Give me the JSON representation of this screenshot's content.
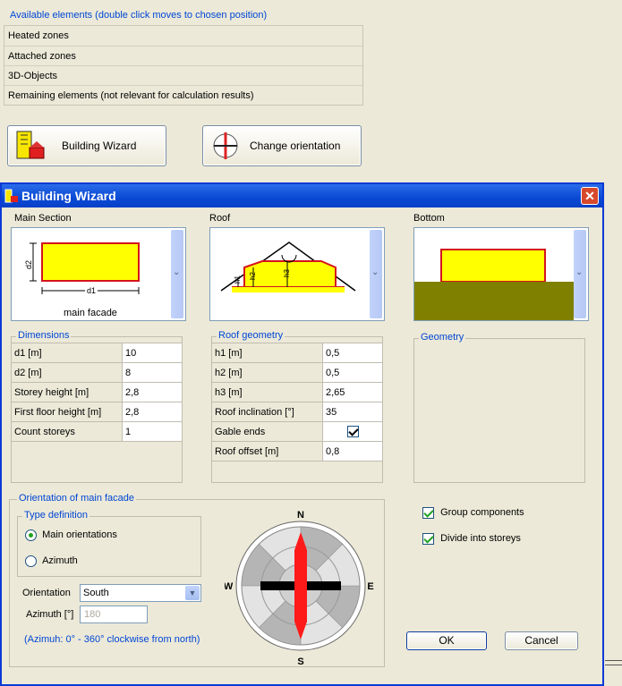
{
  "available": {
    "title": "Available elements (double click moves to chosen position)",
    "rows": [
      "Heated zones",
      "Attached zones",
      "3D-Objects",
      "Remaining elements (not relevant for calculation results)"
    ]
  },
  "toolbar": {
    "wizard_label": "Building Wizard",
    "orientation_label": "Change orientation"
  },
  "dialog": {
    "title": "Building Wizard",
    "main_section": {
      "label": "Main Section",
      "d1": "d1",
      "d2": "d2",
      "caption": "main facade"
    },
    "roof": {
      "label": "Roof",
      "h1": "h1",
      "h2": "h2",
      "h3": "h3"
    },
    "bottom": {
      "label": "Bottom"
    },
    "dimensions": {
      "title": "Dimensions",
      "rows": [
        {
          "label": "d1  [m]",
          "value": "10"
        },
        {
          "label": "d2  [m]",
          "value": "8"
        },
        {
          "label": "Storey height  [m]",
          "value": "2,8"
        },
        {
          "label": "First floor height  [m]",
          "value": "2,8"
        },
        {
          "label": "Count storeys",
          "value": "1"
        }
      ]
    },
    "roof_geometry": {
      "title": "Roof geometry",
      "rows": [
        {
          "label": "h1  [m]",
          "value": "0,5"
        },
        {
          "label": "h2  [m]",
          "value": "0,5"
        },
        {
          "label": "h3  [m]",
          "value": "2,65"
        },
        {
          "label": "Roof inclination  [°]",
          "value": "35"
        },
        {
          "label": "Gable ends",
          "value": ""
        },
        {
          "label": "Roof offset  [m]",
          "value": "0,8"
        }
      ],
      "gable_ends_checked": true
    },
    "geometry": {
      "title": "Geometry"
    },
    "orientation": {
      "title": "Orientation of main facade",
      "type_title": "Type definition",
      "main_label": "Main orientations",
      "azimuth_label": "Azimuth",
      "selected": "Main orientations",
      "orientation_label": "Orientation",
      "orientation_value": "South",
      "azimuth_field_label": "Azimuth [°]",
      "azimuth_value": "180",
      "hint": "(Azimuh: 0° - 360° clockwise from north)",
      "compass": {
        "n": "N",
        "s": "S",
        "e": "E",
        "w": "W"
      }
    },
    "options": {
      "group_label": "Group components",
      "group_checked": true,
      "divide_label": "Divide into storeys",
      "divide_checked": true
    },
    "ok_label": "OK",
    "cancel_label": "Cancel"
  }
}
